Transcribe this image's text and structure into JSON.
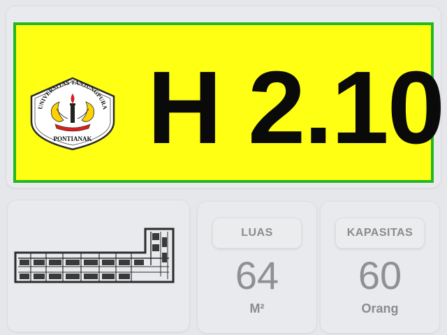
{
  "plate": {
    "room_code": "H 2.10",
    "logo": {
      "top_text": "UNIVERSITAS TANJUNGPURA",
      "bottom_text": "PONTIANAK"
    },
    "colors": {
      "background": "#ffff14",
      "border": "#22b822",
      "text": "#0a0a0a"
    }
  },
  "stats": {
    "area": {
      "label": "LUAS",
      "value": "64",
      "unit": "M²"
    },
    "capacity": {
      "label": "KAPASITAS",
      "value": "60",
      "unit": "Orang"
    }
  },
  "map": {
    "icon": "floor-plan-map"
  }
}
